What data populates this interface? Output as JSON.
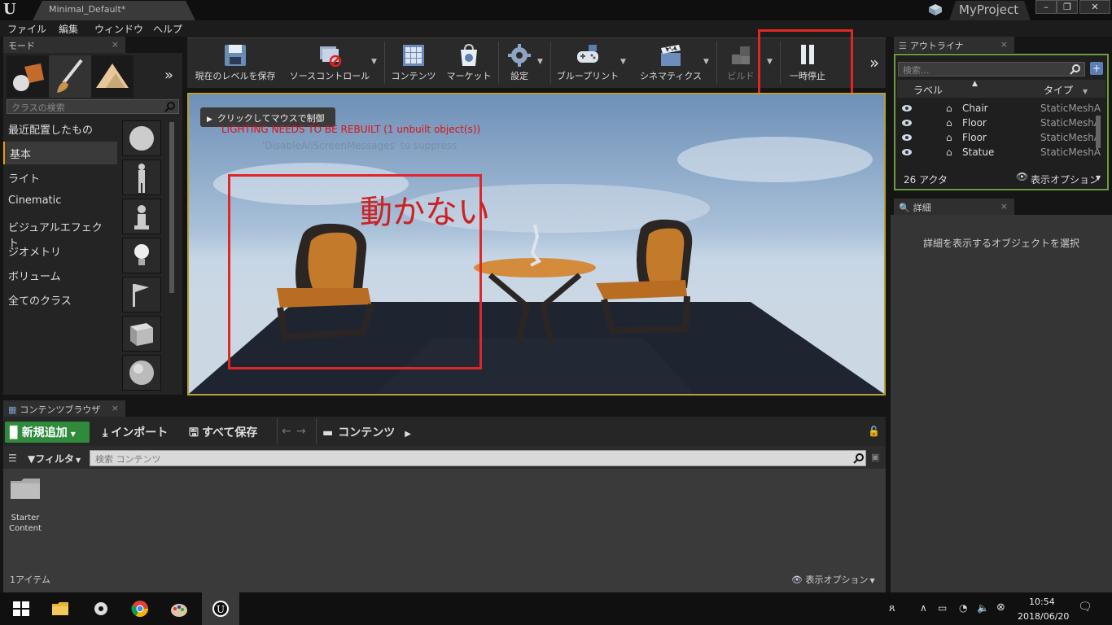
{
  "window": {
    "document_tab": "Minimal_Default*",
    "project": "MyProject",
    "min_glyph": "–",
    "max_glyph": "❐",
    "close_glyph": "✕"
  },
  "menu": [
    "ファイル",
    "編集",
    "ウィンドウ",
    "ヘルプ"
  ],
  "modes": {
    "tab_label": "モード",
    "search_placeholder": "クラスの検索",
    "categories": [
      "最近配置したもの",
      "基本",
      "ライト",
      "Cinematic",
      "ビジュアルエフェクト",
      "ジオメトリ",
      "ボリューム",
      "全てのクラス"
    ],
    "active_category": "基本"
  },
  "toolbar": {
    "buttons": [
      "現在のレベルを保存",
      "ソースコントロール",
      "コンテンツ",
      "マーケット",
      "設定",
      "ブループリント",
      "シネマティクス",
      "ビルド",
      "一時停止"
    ],
    "more": "»"
  },
  "viewport": {
    "hint": "クリックしてマウスで制御",
    "warning": "LIGHTING NEEDS TO BE REBUILT (1 unbuilt object(s))",
    "suppress": "'DisableAllScreenMessages' to suppress",
    "annotation": "動かない"
  },
  "outliner": {
    "tab_label": "アウトライナ",
    "search_placeholder": "検索...",
    "col_label": "ラベル",
    "col_type": "タイプ",
    "rows": [
      {
        "label": "Chair",
        "type": "StaticMeshA"
      },
      {
        "label": "Floor",
        "type": "StaticMeshA"
      },
      {
        "label": "Floor",
        "type": "StaticMeshA"
      },
      {
        "label": "Statue",
        "type": "StaticMeshA"
      }
    ],
    "count": "26 アクタ",
    "view_options": "表示オプション"
  },
  "details": {
    "tab_label": "詳細",
    "empty_message": "詳細を表示するオブジェクトを選択"
  },
  "content_browser": {
    "tab_label": "コンテンツブラウザ",
    "add_new": "新規追加",
    "import": "インポート",
    "save_all": "すべて保存",
    "path": "コンテンツ",
    "filter": "フィルタ",
    "search_placeholder": "検索 コンテンツ",
    "folder_line1": "Starter",
    "folder_line2": "Content",
    "item_count": "1アイテム",
    "view_options": "表示オプション"
  },
  "taskbar": {
    "time": "10:54",
    "date": "2018/06/20"
  },
  "colors": {
    "annotation_red": "#e12626",
    "viewport_border": "#b8a030",
    "outliner_border": "#6b9d3c",
    "add_new_green": "#2f8a3b"
  }
}
